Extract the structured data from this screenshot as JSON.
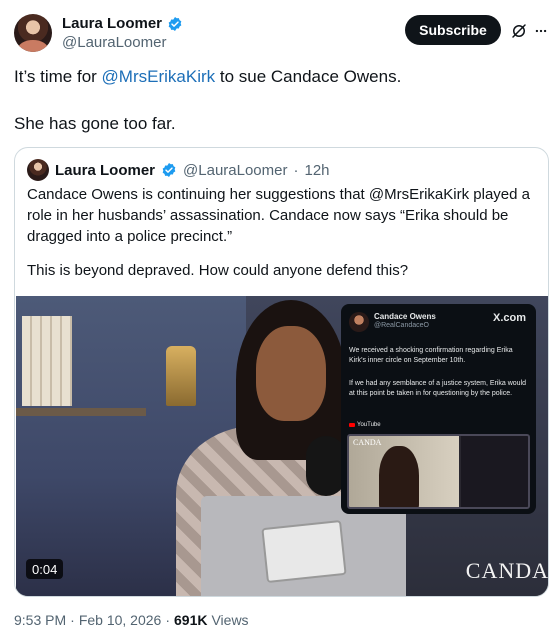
{
  "author": {
    "display_name": "Laura Loomer",
    "handle": "@LauraLoomer",
    "subscribe_label": "Subscribe"
  },
  "post": {
    "line1_prefix": "It’s time for ",
    "line1_mention": "@MrsErikaKirk",
    "line1_suffix": " to sue Candace Owens.",
    "line2": "She has gone too far."
  },
  "quoted": {
    "display_name": "Laura Loomer",
    "handle": "@LauraLoomer",
    "separator": "·",
    "time": "12h",
    "text_p1": "Candace Owens is continuing her suggestions that @MrsErikaKirk played a role in her husbands’ assassination. Candace now says “Erika should be dragged into a police precinct.”",
    "text_p2": "This is beyond depraved. How could anyone defend this?",
    "media": {
      "duration": "0:04",
      "brand_text": "CANDA",
      "embedded_post": {
        "name": "Candace Owens",
        "handle": "@RealCandaceO",
        "site": "X.com",
        "text1": "We received a shocking confirmation regarding Erika Kirk’s inner circle on September 10th.",
        "text2": "If we had any semblance of a justice system, Erika would at this point be taken in for questioning by the police.",
        "source": "YouTube",
        "thumb_brand": "CANDA"
      }
    }
  },
  "meta": {
    "time": "9:53 PM",
    "separator1": "·",
    "date": "Feb 10, 2026",
    "separator2": "·",
    "views_count": "691K",
    "views_label": "Views"
  },
  "colors": {
    "mention": "#1d6fb8",
    "verified": "#1d9bf0",
    "subscribe_bg": "#0f1419"
  }
}
